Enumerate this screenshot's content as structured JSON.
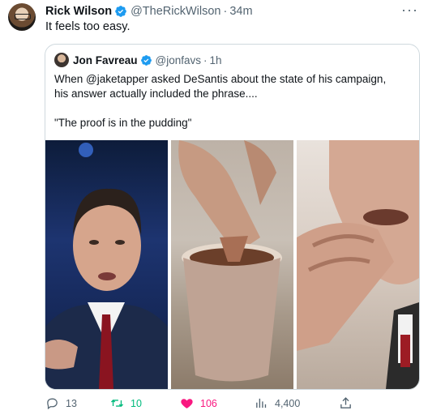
{
  "tweet": {
    "author_name": "Rick Wilson",
    "handle": "@TheRickWilson",
    "time": "34m",
    "text": "It feels too easy.",
    "more_glyph": "···"
  },
  "quote": {
    "author_name": "Jon Favreau",
    "handle": "@jonfavs",
    "time": "1h",
    "line1": "When @jaketapper asked DeSantis about the state of his campaign,",
    "line2": "his answer actually included the phrase....",
    "line3": "\"The proof is in the pudding\""
  },
  "actions": {
    "replies": "13",
    "retweets": "10",
    "likes": "106",
    "views": "4,400"
  },
  "colors": {
    "verified": "#1d9bf0",
    "retweet_active": "#00ba7c",
    "like_active": "#f91880",
    "muted": "#536471"
  },
  "icons": [
    "verified-badge-icon",
    "more-icon",
    "reply-icon",
    "retweet-icon",
    "heart-icon",
    "views-icon",
    "share-icon"
  ]
}
